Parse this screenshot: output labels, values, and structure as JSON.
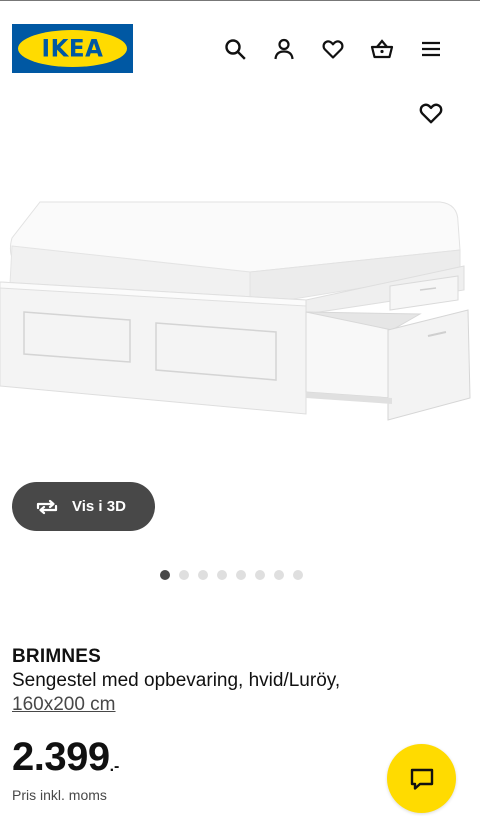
{
  "brand": {
    "logo_text": "IKEA",
    "blue": "#0058a3",
    "yellow": "#ffdb00"
  },
  "header_icons": [
    "search-icon",
    "account-icon",
    "favourites-icon",
    "basket-icon",
    "menu-icon"
  ],
  "product": {
    "name": "BRIMNES",
    "description": "Sengestel med opbevaring, hvid/Luröy,",
    "size": "160x200 cm",
    "price": "2.399",
    "price_suffix": ".-",
    "price_note": "Pris inkl. moms"
  },
  "gallery": {
    "view_3d_label": "Vis i 3D",
    "image_count": 8,
    "active_index": 0
  },
  "chat": {
    "icon": "chat-icon"
  }
}
